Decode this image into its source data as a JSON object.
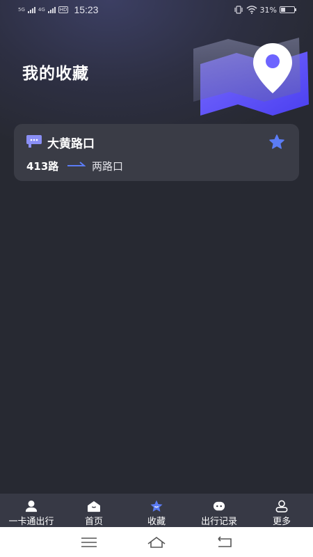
{
  "status_bar": {
    "network1": "5G",
    "network2": "4G",
    "hd": "HD",
    "time": "15:23",
    "battery": "31%",
    "battery_level": 0.31
  },
  "page": {
    "title": "我的收藏"
  },
  "favorites": [
    {
      "stop_name": "大黄路口",
      "route": "413路",
      "destination": "两路口",
      "starred": true
    }
  ],
  "tabs": [
    {
      "label": "一卡通出行",
      "icon": "person-icon",
      "active": false
    },
    {
      "label": "首页",
      "icon": "home-icon",
      "active": false
    },
    {
      "label": "收藏",
      "icon": "star-icon",
      "active": true
    },
    {
      "label": "出行记录",
      "icon": "robot-icon",
      "active": false
    },
    {
      "label": "更多",
      "icon": "user-outline-icon",
      "active": false
    }
  ],
  "colors": {
    "background": "#272932",
    "card": "#3a3c46",
    "accent": "#5b7cf5",
    "tab_bar": "#373945"
  }
}
